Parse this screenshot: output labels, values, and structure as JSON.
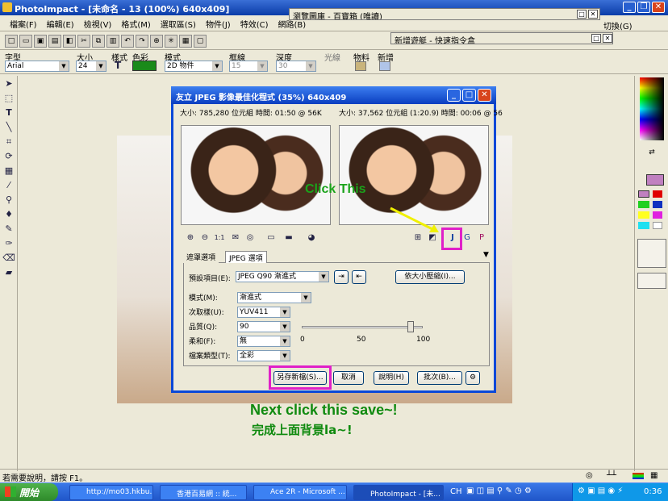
{
  "app": {
    "title": "PhotoImpact - [未命名 - 13 (100%) 640x409]",
    "title_buttons": [
      "_",
      "❐",
      "✕"
    ]
  },
  "menubar": [
    "檔案(F)",
    "編輯(E)",
    "檢視(V)",
    "格式(M)",
    "選取區(S)",
    "物件(J)",
    "特效(C)",
    "網路(B)"
  ],
  "float_panels": {
    "browser": "瀏覽圖庫 - 百寶箱 (唯讀)",
    "quick": "新增遊艇 - 快速指令盒",
    "switch_label": "切換(G)"
  },
  "attrbar": {
    "font_label": "字型",
    "font_value": "Arial",
    "size_label": "大小",
    "size_value": "24",
    "style_label": "樣式",
    "color_label": "色彩",
    "color_value": "#1a8a1a",
    "mode_label": "模式",
    "mode_value": "2D 物件",
    "border_label": "框線",
    "border_value": "15",
    "depth_label": "深度",
    "depth_value": "30",
    "light_label": "光線",
    "material_label": "物料",
    "add_label": "新增"
  },
  "dialog": {
    "title": "友立 JPEG 影像最佳化程式 (35%) 640x409",
    "left_info": "大小: 785,280 位元組 時間: 01:50 @ 56K",
    "right_info": "大小: 37,562 位元組 (1:20.9) 時間: 00:06 @ 56",
    "tabs": [
      "遮罩選項",
      "JPEG 選項"
    ],
    "preset_label": "預設項目(E):",
    "preset_value": "JPEG Q90 漸進式",
    "compress_by_size": "依大小壓縮(I)...",
    "fields": [
      {
        "label": "模式(M):",
        "value": "漸進式"
      },
      {
        "label": "次取樣(U):",
        "value": "YUV411"
      },
      {
        "label": "品質(Q):",
        "value": "90"
      },
      {
        "label": "柔和(F):",
        "value": "無"
      },
      {
        "label": "檔案類型(T):",
        "value": "全彩"
      }
    ],
    "quality": 90,
    "slider_ticks": [
      "0",
      "50",
      "100"
    ],
    "buttons": {
      "save_as": "另存新檔(S)...",
      "cancel": "取消",
      "help": "說明(H)",
      "batch": "批次(B)..."
    }
  },
  "annotations": {
    "click_this": "Click This",
    "next_click": "Next click this save~!",
    "done_up": "完成上面背景la~!"
  },
  "status": "若需要說明，請按 F1。",
  "taskbar": {
    "start": "開始",
    "tasks": [
      "http://mo03.hkbu.n...",
      "香港百易網 :: 統...",
      "Ace 2R - Microsoft ...",
      "PhotoImpact - [未..."
    ],
    "lang": "CH",
    "clock": "0:36"
  }
}
